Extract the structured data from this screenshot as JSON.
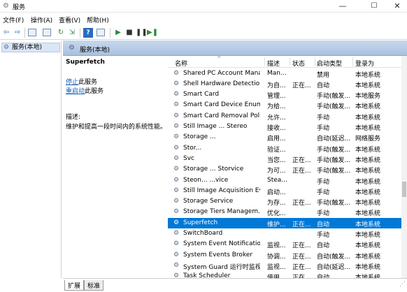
{
  "window": {
    "title": "服务",
    "min_label": "—",
    "max_label": "☐",
    "close_label": "✕"
  },
  "menu": [
    "文件(F)",
    "操作(A)",
    "查看(V)",
    "帮助(H)"
  ],
  "tree": {
    "item": "服务(本地)"
  },
  "panel": {
    "title": "服务(本地)"
  },
  "detail": {
    "service_name": "Superfetch",
    "stop_link": "停止",
    "stop_suffix": "此服务",
    "restart_link": "重启动",
    "restart_suffix": "此服务",
    "description_label": "描述:",
    "description": "维护和提高一段时间内的系统性能。"
  },
  "columns": [
    "名称",
    "描述",
    "状态",
    "启动类型",
    "登录为"
  ],
  "rows": [
    {
      "name": "Shared PC Account Mana...",
      "desc": "Man...",
      "status": "",
      "start": "禁用",
      "logon": "本地系统"
    },
    {
      "name": "Shell Hardware Detection",
      "desc": "为自...",
      "status": "正在...",
      "start": "自动",
      "logon": "本地系统"
    },
    {
      "name": "Smart Card",
      "desc": "管理...",
      "status": "",
      "start": "手动(触发...",
      "logon": "本地服务"
    },
    {
      "name": "Smart Card Device Enum...",
      "desc": "为给...",
      "status": "",
      "start": "手动(触发...",
      "logon": "本地系统"
    },
    {
      "name": "Smart Card Removal Poli...",
      "desc": "允许...",
      "status": "",
      "start": "手动",
      "logon": "本地系统"
    },
    {
      "name": "Still Image ... Stereo",
      "desc": "接收...",
      "status": "",
      "start": "手动",
      "logon": "本地系统"
    },
    {
      "name": "Storage ...",
      "desc": "启用...",
      "status": "",
      "start": "自动(延迟...",
      "logon": "网络服务"
    },
    {
      "name": "Stor...",
      "desc": "验证...",
      "status": "",
      "start": "手动(触发...",
      "logon": "本地系统"
    },
    {
      "name": "Svc",
      "desc": "当您...",
      "status": "正在...",
      "start": "手动(触发...",
      "logon": "本地系统"
    },
    {
      "name": "Storage ... Storvice",
      "desc": "为可...",
      "status": "正在...",
      "start": "手动(触发...",
      "logon": "本地系统"
    },
    {
      "name": "Steon... ...vice",
      "desc": "Stea...",
      "status": "",
      "start": "手动",
      "logon": "本地系统"
    },
    {
      "name": "Still Image Acquisition Ev...",
      "desc": "启动...",
      "status": "",
      "start": "手动",
      "logon": "本地系统"
    },
    {
      "name": "Storage Service",
      "desc": "为存...",
      "status": "正在...",
      "start": "手动(触发...",
      "logon": "本地系统"
    },
    {
      "name": "Storage Tiers Managem...",
      "desc": "优化...",
      "status": "",
      "start": "手动",
      "logon": "本地系统"
    },
    {
      "name": "Superfetch",
      "desc": "维护...",
      "status": "正在...",
      "start": "自动",
      "logon": "本地系统"
    },
    {
      "name": "SwitchBoard",
      "desc": "",
      "status": "",
      "start": "手动",
      "logon": "本地系统"
    },
    {
      "name": "System Event Notification...",
      "desc": "监视...",
      "status": "正在...",
      "start": "自动",
      "logon": "本地系统"
    },
    {
      "name": "System Events Broker",
      "desc": "协调...",
      "status": "正在...",
      "start": "自动(触发...",
      "logon": "本地系统"
    },
    {
      "name": "System Guard 运行时监视...",
      "desc": "监视...",
      "status": "正在...",
      "start": "自动(延迟...",
      "logon": "本地系统"
    },
    {
      "name": "Task Scheduler",
      "desc": "使用...",
      "status": "正在...",
      "start": "自动",
      "logon": "本地系统"
    }
  ],
  "selected_row": 14,
  "tabs": {
    "expanded": "扩展",
    "standard": "标准"
  }
}
